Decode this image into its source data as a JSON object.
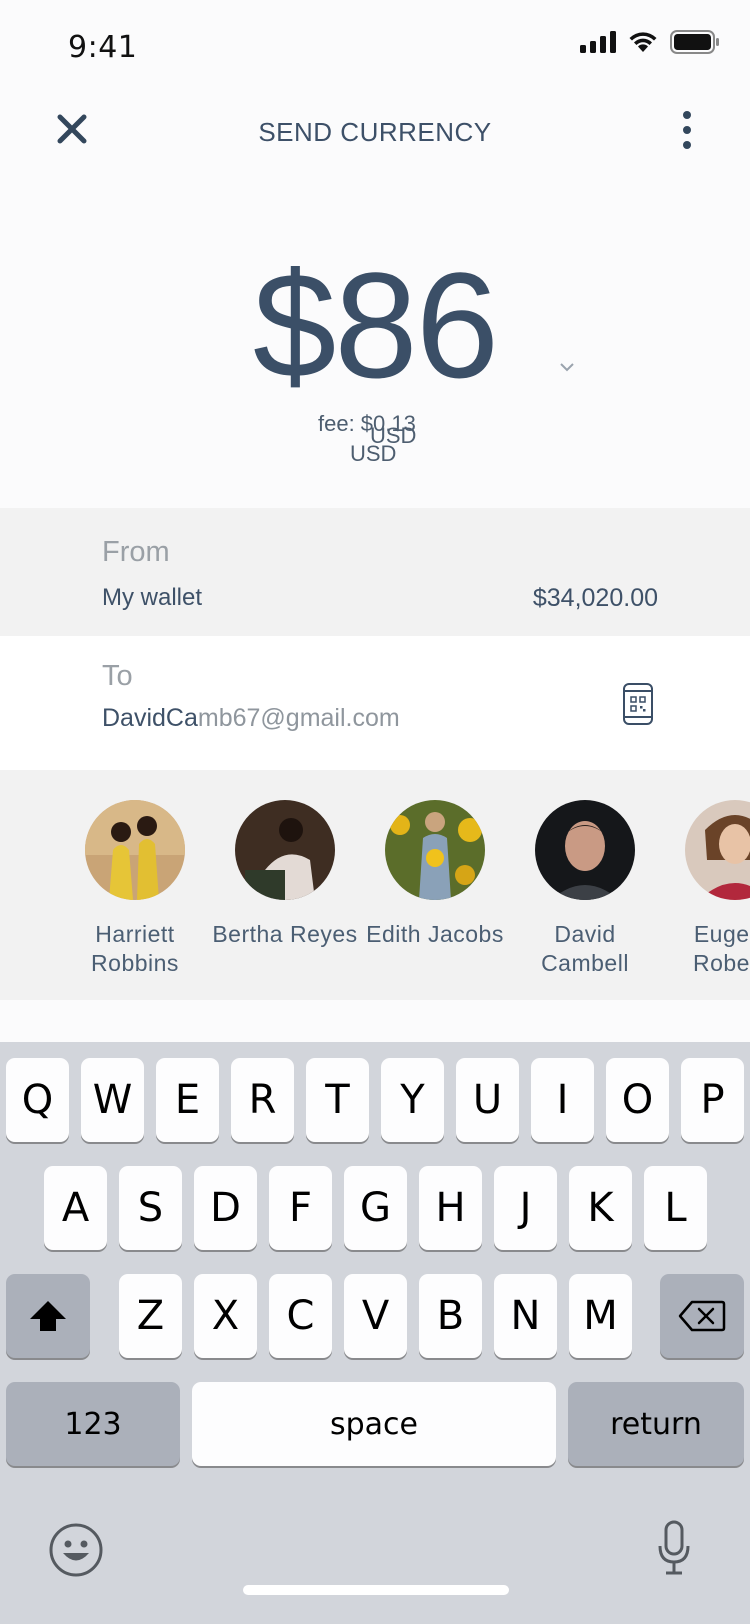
{
  "status_bar": {
    "time": "9:41"
  },
  "nav": {
    "title": "SEND CURRENCY"
  },
  "amount": {
    "value": "$86"
  },
  "fee": {
    "line1": "fee: $0.13",
    "line2": "USD",
    "overlap_text": "USD"
  },
  "from": {
    "label": "From",
    "wallet": "My wallet",
    "balance": "$34,020.00"
  },
  "to": {
    "label": "To",
    "typed": "DavidCa",
    "suggestion": "mb67@gmail.com"
  },
  "contacts": [
    {
      "name": "Harriett Robbins"
    },
    {
      "name": "Bertha Reyes"
    },
    {
      "name": "Edith Jacobs"
    },
    {
      "name": "David Cambell"
    },
    {
      "name": "Eugene Roberts"
    }
  ],
  "keyboard": {
    "row1": [
      "Q",
      "W",
      "E",
      "R",
      "T",
      "Y",
      "U",
      "I",
      "O",
      "P"
    ],
    "row2": [
      "A",
      "S",
      "D",
      "F",
      "G",
      "H",
      "J",
      "K",
      "L"
    ],
    "row3": [
      "Z",
      "X",
      "C",
      "V",
      "B",
      "N",
      "M"
    ],
    "numbers_label": "123",
    "space_label": "space",
    "return_label": "return"
  },
  "colors": {
    "text": "#3b4f67",
    "section_bg": "#f2f2f2",
    "keyboard_bg": "#d2d5db"
  }
}
